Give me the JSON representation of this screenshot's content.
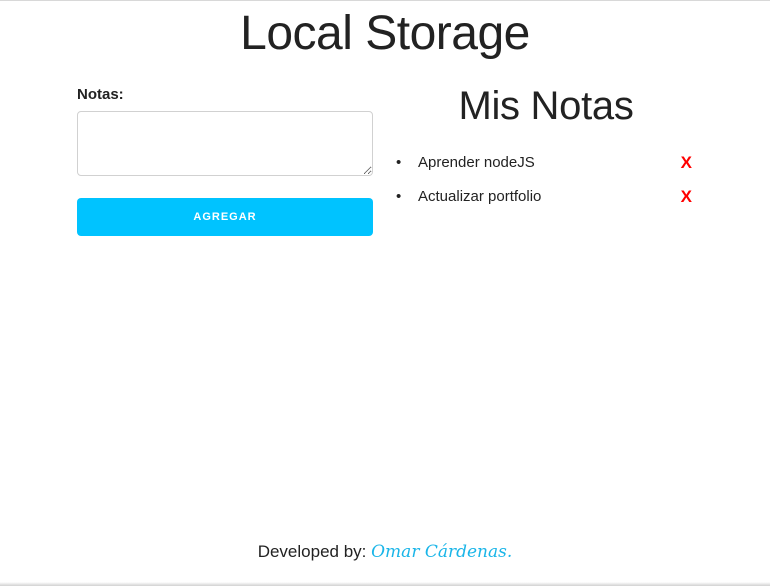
{
  "header": {
    "title": "Local Storage"
  },
  "form": {
    "label": "Notas:",
    "textarea_value": "",
    "textarea_placeholder": "",
    "submit_label": "AGREGAR",
    "submit_color": "#00c3ff"
  },
  "notes": {
    "title": "Mis Notas",
    "bullet": "•",
    "delete_label": "X",
    "delete_color": "#ff0000",
    "items": [
      {
        "text": "Aprender nodeJS"
      },
      {
        "text": "Actualizar portfolio"
      }
    ]
  },
  "footer": {
    "prefix": "Developed by:",
    "author": "Omar Cárdenas.",
    "author_color": "#1ab5e8"
  }
}
